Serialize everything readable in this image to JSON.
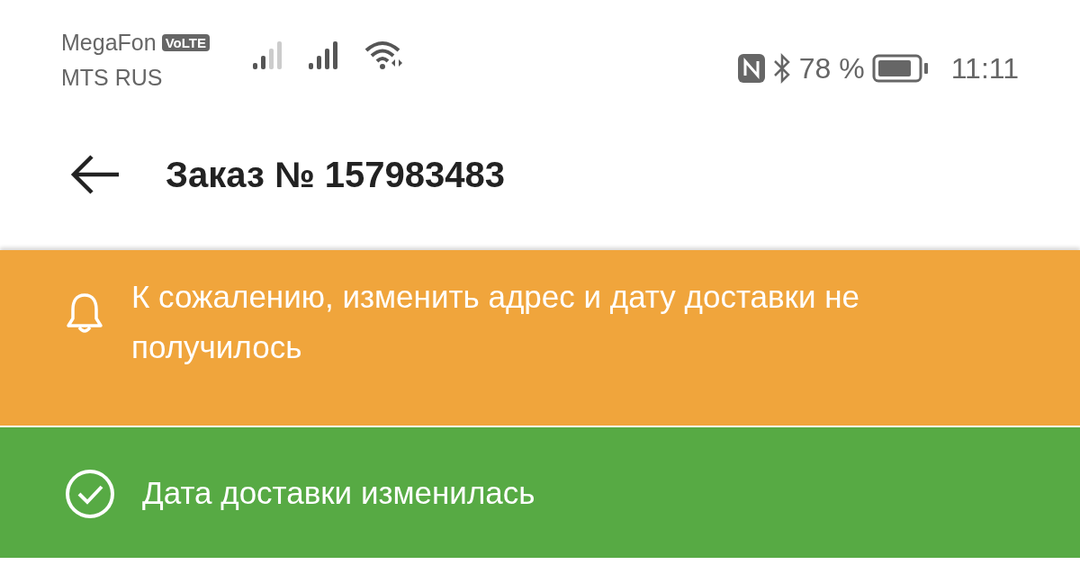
{
  "status_bar": {
    "carriers": [
      {
        "name": "MegaFon",
        "badge": "VoLTE"
      },
      {
        "name": "MTS RUS"
      }
    ],
    "battery": "78 %",
    "time": "11:11"
  },
  "header": {
    "title": "Заказ № 157983483"
  },
  "notifications": [
    {
      "kind": "warning",
      "color": "#f0a53c",
      "text": "К сожалению, изменить адрес и дату доставки не получилось"
    },
    {
      "kind": "success",
      "color": "#57aa44",
      "text": "Дата доставки изменилась"
    }
  ]
}
